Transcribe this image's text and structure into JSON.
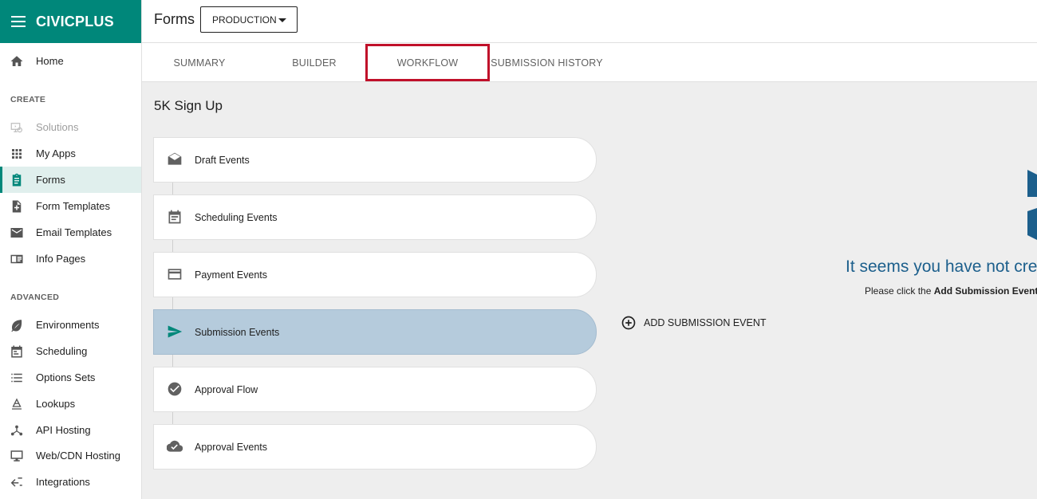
{
  "brand": {
    "name": "CIVICPLUS",
    "color": "#00877a"
  },
  "header": {
    "title": "Forms",
    "environment": "PRODUCTION"
  },
  "sidebar": {
    "home": {
      "label": "Home",
      "icon": "home-icon"
    },
    "create_heading": "CREATE",
    "create_items": [
      {
        "label": "Solutions",
        "icon": "solutions-icon",
        "disabled": true
      },
      {
        "label": "My Apps",
        "icon": "apps-grid-icon"
      },
      {
        "label": "Forms",
        "icon": "clipboard-icon",
        "active": true
      },
      {
        "label": "Form Templates",
        "icon": "file-add-icon"
      },
      {
        "label": "Email Templates",
        "icon": "mail-icon"
      },
      {
        "label": "Info Pages",
        "icon": "info-page-icon"
      }
    ],
    "advanced_heading": "ADVANCED",
    "advanced_items": [
      {
        "label": "Environments",
        "icon": "leaf-icon"
      },
      {
        "label": "Scheduling",
        "icon": "calendar-icon"
      },
      {
        "label": "Options Sets",
        "icon": "list-icon"
      },
      {
        "label": "Lookups",
        "icon": "lookup-icon"
      },
      {
        "label": "API Hosting",
        "icon": "api-icon"
      },
      {
        "label": "Web/CDN Hosting",
        "icon": "monitor-icon"
      },
      {
        "label": "Integrations",
        "icon": "integrations-icon"
      }
    ]
  },
  "tabs": [
    {
      "label": "SUMMARY"
    },
    {
      "label": "BUILDER"
    },
    {
      "label": "WORKFLOW",
      "highlighted": true
    },
    {
      "label": "SUBMISSION HISTORY"
    }
  ],
  "main": {
    "form_name": "5K Sign Up",
    "events": [
      {
        "label": "Draft Events",
        "icon": "draft-mail-icon"
      },
      {
        "label": "Scheduling Events",
        "icon": "calendar-icon"
      },
      {
        "label": "Payment Events",
        "icon": "credit-card-icon"
      },
      {
        "label": "Submission Events",
        "icon": "send-icon",
        "active": true
      },
      {
        "label": "Approval Flow",
        "icon": "check-circle-icon"
      },
      {
        "label": "Approval Events",
        "icon": "cloud-check-icon"
      }
    ],
    "add_button": "ADD SUBMISSION EVENT",
    "empty_title": "It seems you have not cre",
    "empty_sub_prefix": "Please click the ",
    "empty_sub_bold": "Add Submission Event"
  }
}
